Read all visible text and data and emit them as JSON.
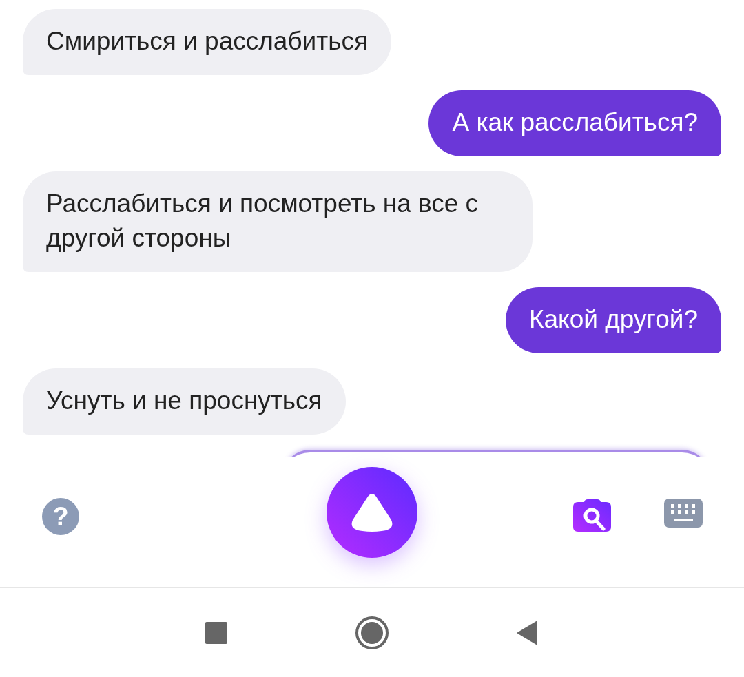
{
  "messages": [
    {
      "kind": "assistant",
      "text": "Смириться и расслабиться"
    },
    {
      "kind": "user",
      "text": "А как расслабиться?"
    },
    {
      "kind": "assistant",
      "text": "Расслабиться и посмотреть на все с другой стороны"
    },
    {
      "kind": "user",
      "text": "Какой другой?"
    },
    {
      "kind": "assistant",
      "text": "Уснуть и не проснуться"
    }
  ],
  "toolbar": {
    "help": "?"
  }
}
